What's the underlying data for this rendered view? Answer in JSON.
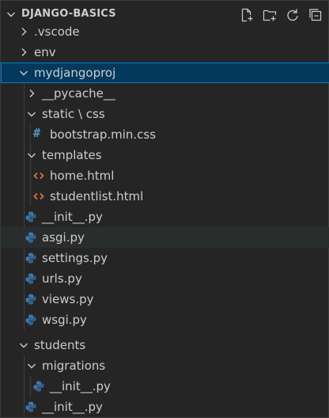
{
  "explorer": {
    "title": "DJANGO-BASICS",
    "actions": [
      {
        "name": "new-file-icon"
      },
      {
        "name": "new-folder-icon"
      },
      {
        "name": "refresh-icon"
      },
      {
        "name": "collapse-all-icon"
      }
    ],
    "items": [
      {
        "label": ".vscode",
        "kind": "folder",
        "expanded": false
      },
      {
        "label": "env",
        "kind": "folder",
        "expanded": false
      },
      {
        "label": "mydjangoproj",
        "kind": "folder",
        "expanded": true,
        "selected": true
      },
      {
        "label": "__pycache__",
        "kind": "folder",
        "expanded": false
      },
      {
        "label": "static \\ css",
        "kind": "folder",
        "expanded": true
      },
      {
        "label": "bootstrap.min.css",
        "kind": "css"
      },
      {
        "label": "templates",
        "kind": "folder",
        "expanded": true
      },
      {
        "label": "home.html",
        "kind": "html"
      },
      {
        "label": "studentlist.html",
        "kind": "html"
      },
      {
        "label": "__init__.py",
        "kind": "python"
      },
      {
        "label": "asgi.py",
        "kind": "python",
        "hover": true
      },
      {
        "label": "settings.py",
        "kind": "python"
      },
      {
        "label": "urls.py",
        "kind": "python"
      },
      {
        "label": "views.py",
        "kind": "python"
      },
      {
        "label": "wsgi.py",
        "kind": "python"
      },
      {
        "label": "students",
        "kind": "folder",
        "expanded": true
      },
      {
        "label": "migrations",
        "kind": "folder",
        "expanded": true
      },
      {
        "label": "__init__.py",
        "kind": "python"
      },
      {
        "label": "__init__.py",
        "kind": "python"
      }
    ]
  },
  "colors": {
    "background": "#252526",
    "selected": "#04395e",
    "selected_border": "#007fd4",
    "python_icon": "#3c79b0",
    "html_icon": "#e37933",
    "css_icon": "#519aba"
  }
}
